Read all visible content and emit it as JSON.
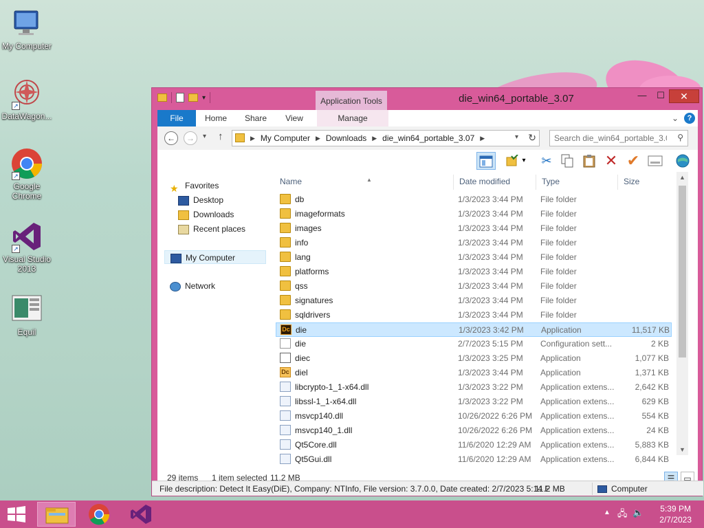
{
  "desktop": {
    "icons": [
      {
        "label": "My Computer"
      },
      {
        "label": "DataWagon..."
      },
      {
        "label": "Google Chrome"
      },
      {
        "label": "Visual Studio 2013"
      },
      {
        "label": "Equil"
      }
    ]
  },
  "window": {
    "title": "die_win64_portable_3.07",
    "context_tab": "Application Tools",
    "controls": {
      "minimize": "—",
      "maximize": "☐",
      "close": "✕"
    }
  },
  "ribbon": {
    "tabs": [
      "File",
      "Home",
      "Share",
      "View",
      "Manage"
    ],
    "help": "?"
  },
  "address": {
    "crumbs": [
      "My Computer",
      "Downloads",
      "die_win64_portable_3.07"
    ],
    "search_placeholder": "Search die_win64_portable_3.07"
  },
  "navpane": {
    "favorites": "Favorites",
    "items": [
      "Desktop",
      "Downloads",
      "Recent places"
    ],
    "computer": "My Computer",
    "network": "Network"
  },
  "columns": {
    "name": "Name",
    "date": "Date modified",
    "type": "Type",
    "size": "Size"
  },
  "files": [
    {
      "name": "db",
      "date": "1/3/2023 3:44 PM",
      "type": "File folder",
      "size": "",
      "icon": "folder"
    },
    {
      "name": "imageformats",
      "date": "1/3/2023 3:44 PM",
      "type": "File folder",
      "size": "",
      "icon": "folder"
    },
    {
      "name": "images",
      "date": "1/3/2023 3:44 PM",
      "type": "File folder",
      "size": "",
      "icon": "folder"
    },
    {
      "name": "info",
      "date": "1/3/2023 3:44 PM",
      "type": "File folder",
      "size": "",
      "icon": "folder"
    },
    {
      "name": "lang",
      "date": "1/3/2023 3:44 PM",
      "type": "File folder",
      "size": "",
      "icon": "folder"
    },
    {
      "name": "platforms",
      "date": "1/3/2023 3:44 PM",
      "type": "File folder",
      "size": "",
      "icon": "folder"
    },
    {
      "name": "qss",
      "date": "1/3/2023 3:44 PM",
      "type": "File folder",
      "size": "",
      "icon": "folder"
    },
    {
      "name": "signatures",
      "date": "1/3/2023 3:44 PM",
      "type": "File folder",
      "size": "",
      "icon": "folder"
    },
    {
      "name": "sqldrivers",
      "date": "1/3/2023 3:44 PM",
      "type": "File folder",
      "size": "",
      "icon": "folder"
    },
    {
      "name": "die",
      "date": "1/3/2023 3:42 PM",
      "type": "Application",
      "size": "11,517 KB",
      "icon": "die",
      "selected": true
    },
    {
      "name": "die",
      "date": "2/7/2023 5:15 PM",
      "type": "Configuration sett...",
      "size": "2 KB",
      "icon": "cfg"
    },
    {
      "name": "diec",
      "date": "1/3/2023 3:25 PM",
      "type": "Application",
      "size": "1,077 KB",
      "icon": "app"
    },
    {
      "name": "diel",
      "date": "1/3/2023 3:44 PM",
      "type": "Application",
      "size": "1,371 KB",
      "icon": "diel"
    },
    {
      "name": "libcrypto-1_1-x64.dll",
      "date": "1/3/2023 3:22 PM",
      "type": "Application extens...",
      "size": "2,642 KB",
      "icon": "dll"
    },
    {
      "name": "libssl-1_1-x64.dll",
      "date": "1/3/2023 3:22 PM",
      "type": "Application extens...",
      "size": "629 KB",
      "icon": "dll"
    },
    {
      "name": "msvcp140.dll",
      "date": "10/26/2022 6:26 PM",
      "type": "Application extens...",
      "size": "554 KB",
      "icon": "dll"
    },
    {
      "name": "msvcp140_1.dll",
      "date": "10/26/2022 6:26 PM",
      "type": "Application extens...",
      "size": "24 KB",
      "icon": "dll"
    },
    {
      "name": "Qt5Core.dll",
      "date": "11/6/2020 12:29 AM",
      "type": "Application extens...",
      "size": "5,883 KB",
      "icon": "dll"
    },
    {
      "name": "Qt5Gui.dll",
      "date": "11/6/2020 12:29 AM",
      "type": "Application extens...",
      "size": "6,844 KB",
      "icon": "dll"
    }
  ],
  "status": {
    "items": "29 items",
    "selected": "1 item selected",
    "size": "11.2 MB"
  },
  "details": {
    "description": "File description: Detect It Easy(DiE), Company: NTInfo, File version: 3.7.0.0, Date created: 2/7/2023 5:14 F",
    "size": "11.2 MB",
    "location": "Computer"
  },
  "taskbar": {
    "time": "5:39 PM",
    "date": "2/7/2023"
  },
  "colors": {
    "window_frame": "#d85b9a",
    "taskbar": "#c94f8c",
    "file_tab": "#1979ca",
    "selection": "#cce8ff"
  }
}
